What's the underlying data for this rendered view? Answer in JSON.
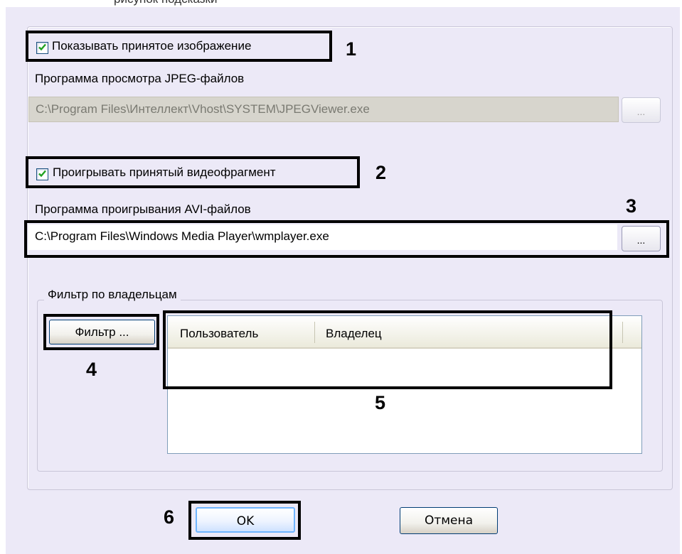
{
  "top_caption": "рисунок подсказки",
  "show_image": {
    "label": "Показывать принятое изображение",
    "checked": true,
    "callout": "1"
  },
  "jpeg_viewer": {
    "label": "Программа просмотра JPEG-файлов",
    "value": "C:\\Program Files\\Интеллект\\Vhost\\SYSTEM\\JPEGViewer.exe",
    "browse_label": "...",
    "enabled": false
  },
  "play_video": {
    "label": "Проигрывать принятый видеофрагмент",
    "checked": true,
    "callout": "2"
  },
  "avi_player": {
    "label": "Программа проигрывания AVI-файлов",
    "value": "C:\\Program Files\\Windows Media Player\\wmplayer.exe",
    "browse_label": "...",
    "enabled": true,
    "callout": "3"
  },
  "owner_filter": {
    "title": "Фильтр по владельцам",
    "filter_button": "Фильтр ...",
    "filter_callout": "4",
    "columns": [
      "Пользователь",
      "Владелец"
    ],
    "rows": [],
    "list_callout": "5"
  },
  "footer": {
    "ok_label": "OK",
    "cancel_label": "Отмена",
    "ok_callout": "6"
  },
  "colors": {
    "dialog_bg": "#ECE9F7",
    "callout_border": "#000000",
    "checkbox_border": "#1C5180",
    "checkmark": "#21A121",
    "disabled_field": "#D7D5CD"
  },
  "icons": {
    "checkbox": "check-icon"
  }
}
